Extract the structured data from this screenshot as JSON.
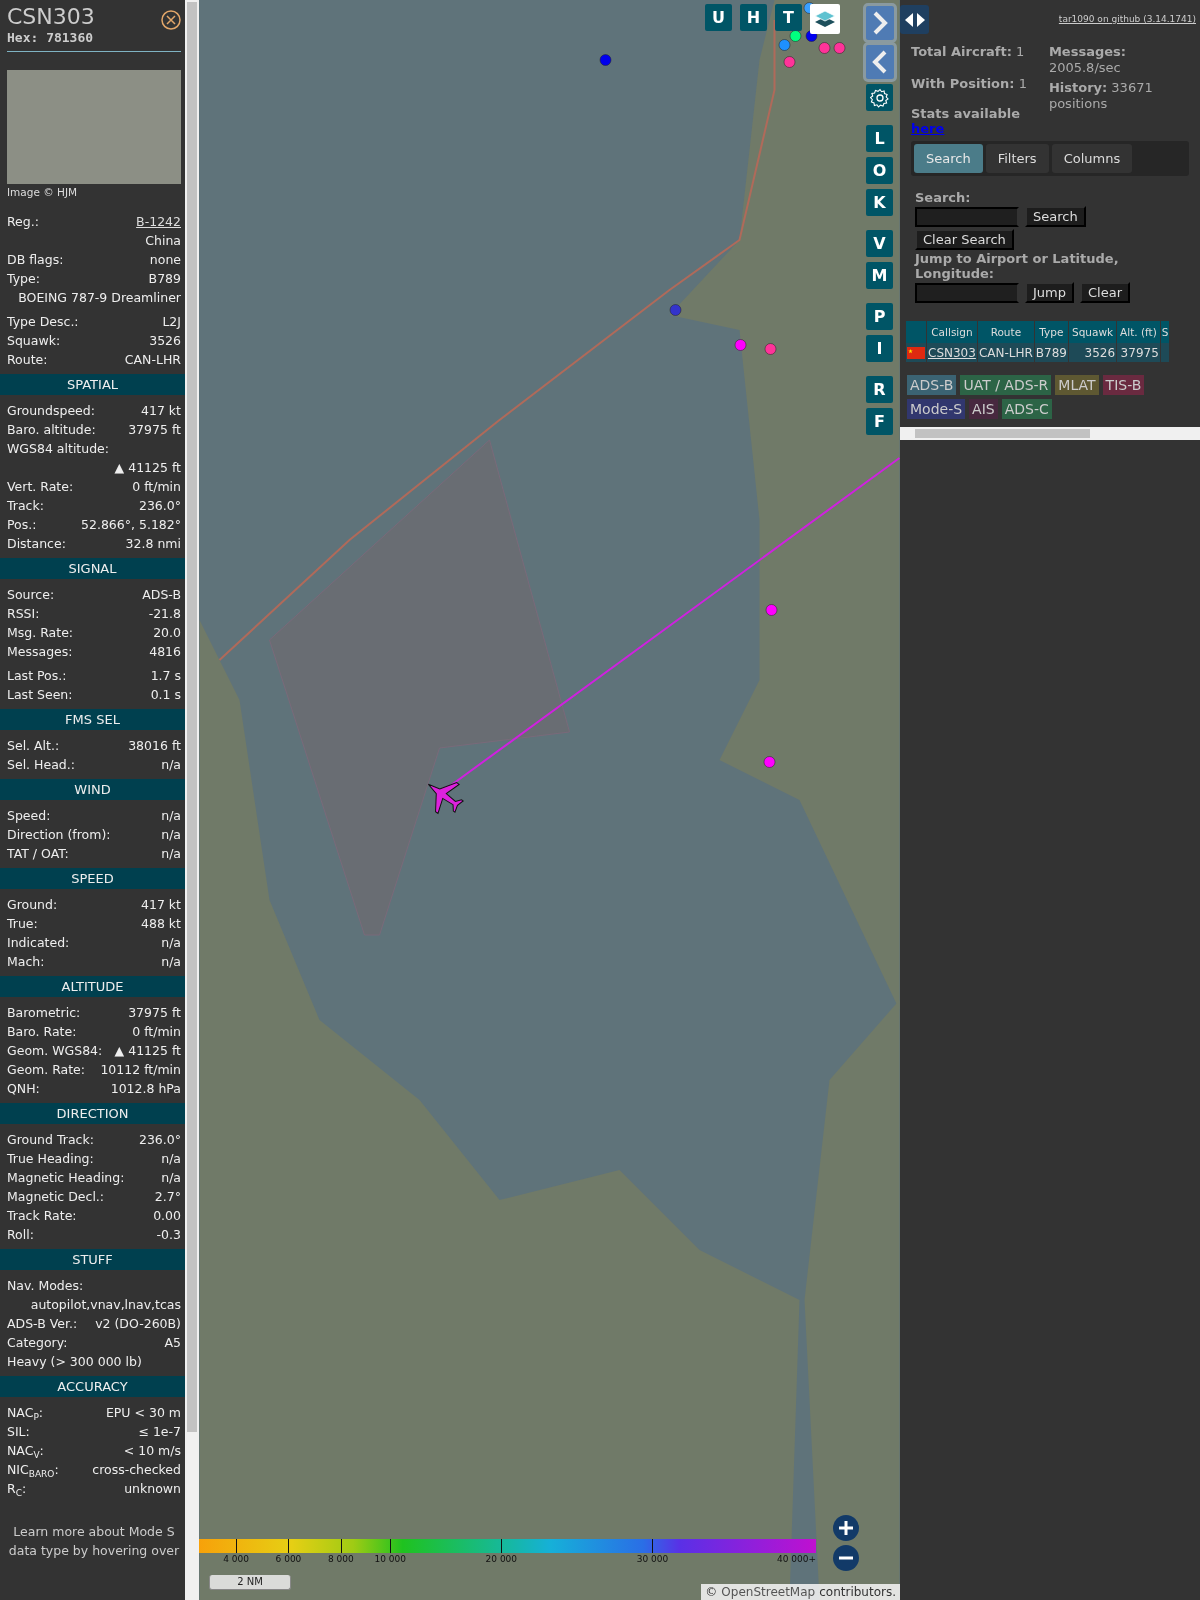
{
  "aircraft": {
    "callsign": "CSN303",
    "hex": "Hex: 781360"
  },
  "photo": {
    "caption": "Image © HJM"
  },
  "details": [
    {
      "groups": [
        [
          {
            "kind": "pair",
            "label": "Reg.:",
            "value": "B-1242",
            "link": true
          },
          {
            "kind": "value",
            "value": "China"
          },
          {
            "kind": "pair",
            "label": "DB flags:",
            "value": "none"
          },
          {
            "kind": "pair",
            "label": "Type:",
            "value": "B789"
          },
          {
            "kind": "value",
            "value": "BOEING 787-9 Dreamliner"
          }
        ],
        [
          {
            "kind": "pair",
            "label": "Type Desc.:",
            "value": "L2J"
          },
          {
            "kind": "pair",
            "label": "Squawk:",
            "value": "3526"
          },
          {
            "kind": "pair",
            "label": "Route:",
            "value": "CAN-LHR"
          }
        ]
      ]
    },
    {
      "title": "SPATIAL",
      "groups": [
        [
          {
            "kind": "pair",
            "label": "Groundspeed:",
            "value": "417 kt"
          },
          {
            "kind": "pair",
            "label": "Baro. altitude:",
            "value": "37975 ft"
          },
          {
            "kind": "label",
            "label": "WGS84 altitude:"
          },
          {
            "kind": "value",
            "value": "▲ 41125 ft"
          },
          {
            "kind": "pair",
            "label": "Vert. Rate:",
            "value": "0 ft/min"
          },
          {
            "kind": "pair",
            "label": "Track:",
            "value": "236.0°"
          },
          {
            "kind": "pair",
            "label": "Pos.:",
            "value": "52.866°, 5.182°"
          },
          {
            "kind": "pair",
            "label": "Distance:",
            "value": "32.8 nmi"
          }
        ]
      ]
    },
    {
      "title": "SIGNAL",
      "groups": [
        [
          {
            "kind": "pair",
            "label": "Source:",
            "value": "ADS-B"
          },
          {
            "kind": "pair",
            "label": "RSSI:",
            "value": "-21.8"
          },
          {
            "kind": "pair",
            "label": "Msg. Rate:",
            "value": "20.0"
          },
          {
            "kind": "pair",
            "label": "Messages:",
            "value": "4816"
          }
        ],
        [
          {
            "kind": "pair",
            "label": "Last Pos.:",
            "value": "1.7 s"
          },
          {
            "kind": "pair",
            "label": "Last Seen:",
            "value": "0.1 s"
          }
        ]
      ]
    },
    {
      "title": "FMS SEL",
      "groups": [
        [
          {
            "kind": "pair",
            "label": "Sel. Alt.:",
            "value": "38016 ft"
          },
          {
            "kind": "pair",
            "label": "Sel. Head.:",
            "value": "n/a"
          }
        ]
      ]
    },
    {
      "title": "WIND",
      "groups": [
        [
          {
            "kind": "pair",
            "label": "Speed:",
            "value": "n/a"
          },
          {
            "kind": "pair",
            "label": "Direction (from):",
            "value": "n/a"
          },
          {
            "kind": "pair",
            "label": "TAT / OAT:",
            "value": "n/a"
          }
        ]
      ]
    },
    {
      "title": "SPEED",
      "groups": [
        [
          {
            "kind": "pair",
            "label": "Ground:",
            "value": "417 kt"
          },
          {
            "kind": "pair",
            "label": "True:",
            "value": "488 kt"
          },
          {
            "kind": "pair",
            "label": "Indicated:",
            "value": "n/a"
          },
          {
            "kind": "pair",
            "label": "Mach:",
            "value": "n/a"
          }
        ]
      ]
    },
    {
      "title": "ALTITUDE",
      "groups": [
        [
          {
            "kind": "pair",
            "label": "Barometric:",
            "value": "37975 ft"
          },
          {
            "kind": "pair",
            "label": "Baro. Rate:",
            "value": "0 ft/min"
          },
          {
            "kind": "pair",
            "label": "Geom. WGS84:",
            "value": "▲ 41125 ft"
          },
          {
            "kind": "pair",
            "label": "Geom. Rate:",
            "value": "10112 ft/min"
          },
          {
            "kind": "pair",
            "label": "QNH:",
            "value": "1012.8 hPa"
          }
        ]
      ]
    },
    {
      "title": "DIRECTION",
      "groups": [
        [
          {
            "kind": "pair",
            "label": "Ground Track:",
            "value": "236.0°"
          },
          {
            "kind": "pair",
            "label": "True Heading:",
            "value": "n/a"
          },
          {
            "kind": "pair",
            "label": "Magnetic Heading:",
            "value": "n/a"
          },
          {
            "kind": "pair",
            "label": "Magnetic Decl.:",
            "value": "2.7°"
          },
          {
            "kind": "pair",
            "label": "Track Rate:",
            "value": "0.00"
          },
          {
            "kind": "pair",
            "label": "Roll:",
            "value": "-0.3"
          }
        ]
      ]
    },
    {
      "title": "STUFF",
      "groups": [
        [
          {
            "kind": "label",
            "label": "Nav. Modes:"
          },
          {
            "kind": "value",
            "value": "autopilot,vnav,lnav,tcas"
          },
          {
            "kind": "pair",
            "label": "ADS-B Ver.:",
            "value": "v2 (DO-260B)"
          },
          {
            "kind": "pair",
            "label": "Category:",
            "value": "A5"
          },
          {
            "kind": "label",
            "label": "Heavy (> 300 000 lb)"
          }
        ]
      ]
    },
    {
      "title": "ACCURACY",
      "groups": [
        [
          {
            "kind": "pair",
            "label": "NAC$_{P}$:",
            "value": "EPU < 30 m"
          },
          {
            "kind": "pair",
            "label": "SIL:",
            "value": "≤ 1e-7"
          },
          {
            "kind": "pair",
            "label": "NAC$_{V}$:",
            "value": "< 10 m/s"
          },
          {
            "kind": "pair",
            "label": "NIC$_{BARO}$:",
            "value": "cross-checked"
          },
          {
            "kind": "pair",
            "label": "R$_{C}$:",
            "value": "unknown"
          }
        ]
      ]
    }
  ],
  "footer_note": "Learn more about Mode S data type by hovering over",
  "map_controls": {
    "top_row": [
      {
        "kind": "letter",
        "label": "U"
      },
      {
        "kind": "letter",
        "label": "H"
      },
      {
        "kind": "letter",
        "label": "T"
      },
      {
        "kind": "layers"
      }
    ],
    "side_groups": [
      [
        {
          "kind": "next"
        },
        {
          "kind": "prev"
        },
        {
          "kind": "settings"
        }
      ],
      [
        {
          "kind": "letter",
          "label": "L"
        },
        {
          "kind": "letter",
          "label": "O"
        },
        {
          "kind": "letter",
          "label": "K"
        }
      ],
      [
        {
          "kind": "letter",
          "label": "V"
        },
        {
          "kind": "letter",
          "label": "M"
        }
      ],
      [
        {
          "kind": "letter",
          "label": "P"
        },
        {
          "kind": "letter",
          "label": "I"
        }
      ],
      [
        {
          "kind": "letter",
          "label": "R"
        },
        {
          "kind": "letter",
          "label": "F"
        }
      ]
    ]
  },
  "altitude_legend": [
    "4 000",
    "6 000",
    "8 000",
    "10 000",
    "20 000",
    "30 000",
    "40 000+"
  ],
  "scale": "2 NM",
  "attribution": {
    "prefix": "©",
    "link": "OpenStreetMap",
    "suffix": "contributors."
  },
  "right_panel": {
    "version_link": "tar1090 on github (3.14.1741)",
    "stats_left": [
      "**Total Aircraft:** 1",
      "**With Position:** 1"
    ],
    "stats_available": {
      "text": "Stats available",
      "link": "here"
    },
    "stats_right": [
      "**Messages:** 2005.8/sec",
      "**History:** 33671 positions"
    ],
    "tabs": [
      {
        "label": "Search",
        "selected": true
      },
      {
        "label": "Filters",
        "selected": false
      },
      {
        "label": "Columns",
        "selected": false
      }
    ],
    "search": {
      "label": "Search:",
      "button": "Search",
      "clear_button": "Clear Search"
    },
    "jump": {
      "label": "Jump to Airport or Latitude, Longitude:",
      "button": "Jump",
      "clear_button": "Clear"
    },
    "table": {
      "columns": [
        "Callsign",
        "Route",
        "Type",
        "Squawk",
        "Alt. (ft)",
        "S"
      ],
      "rows": [
        {
          "cells": [
            "CSN303",
            "CAN-LHR",
            "B789",
            "3526",
            "37975"
          ]
        }
      ]
    },
    "sources": [
      {
        "label": "ADS-B",
        "color": "#3b6373"
      },
      {
        "label": "UAT / ADS-R",
        "color": "#2c6446"
      },
      {
        "label": "MLAT",
        "color": "#5e5832"
      },
      {
        "label": "TIS-B",
        "color": "#6a2a40"
      },
      {
        "label": "Mode-S",
        "color": "#31376e"
      },
      {
        "label": "AIS",
        "color": "#47283f"
      },
      {
        "label": "ADS-C",
        "color": "#2c6446"
      }
    ]
  }
}
